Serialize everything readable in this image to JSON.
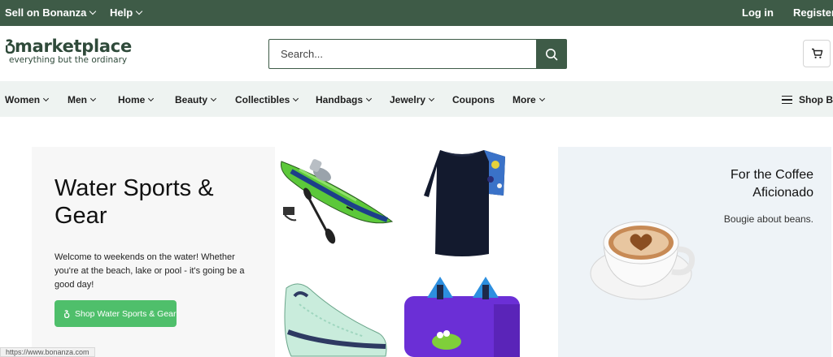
{
  "topbar": {
    "sell_label": "Sell on Bonanza",
    "help_label": "Help",
    "login_label": "Log in",
    "register_label": "Register"
  },
  "header": {
    "logo_text": "marketplace",
    "logo_tagline": "everything but the ordinary",
    "search_placeholder": "Search...",
    "cart_icon": "cart-icon",
    "search_icon": "search-icon"
  },
  "nav": {
    "items": [
      {
        "label": "Women",
        "dropdown": true
      },
      {
        "label": "Men",
        "dropdown": true
      },
      {
        "label": "Home",
        "dropdown": true
      },
      {
        "label": "Beauty",
        "dropdown": true
      },
      {
        "label": "Collectibles",
        "dropdown": true
      },
      {
        "label": "Handbags",
        "dropdown": true
      },
      {
        "label": "Jewelry",
        "dropdown": true
      },
      {
        "label": "Coupons",
        "dropdown": false
      },
      {
        "label": "More",
        "dropdown": true
      }
    ],
    "shop_by_label": "Shop By"
  },
  "hero": {
    "title": "Water Sports & Gear",
    "description": "Welcome to weekends on the water! Whether you're at the beach, lake or pool - it's going be a good day!",
    "button_label": "Shop Water Sports & Gear"
  },
  "products": [
    {
      "icon": "kayak-image"
    },
    {
      "icon": "rash-guard-shirt-image"
    },
    {
      "icon": "water-shoe-image"
    },
    {
      "icon": "swim-float-vest-image"
    }
  ],
  "coffee": {
    "title": "For the Coffee Aficionado",
    "subtitle": "Bougie about beans."
  },
  "status_bar": {
    "url": "https://www.bonanza.com"
  },
  "colors": {
    "brand_green": "#3e5b47",
    "button_green": "#4fbf6b",
    "nav_bg": "#eef3f1"
  }
}
